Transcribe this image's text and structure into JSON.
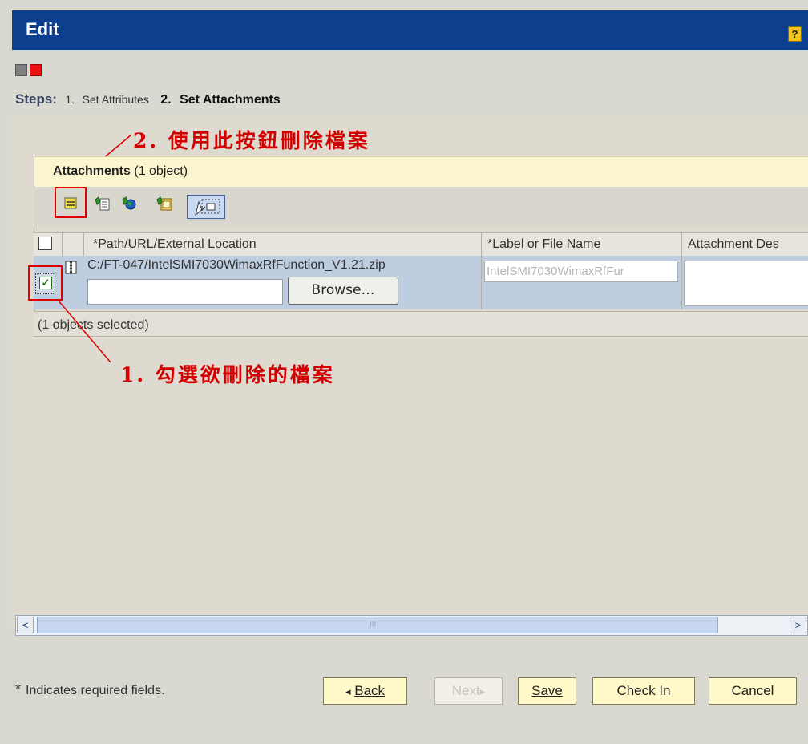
{
  "window": {
    "title": "Edit",
    "help_label": "?"
  },
  "steps": {
    "label": "Steps:",
    "items": [
      {
        "number": "1.",
        "label": "Set Attributes"
      },
      {
        "number": "2.",
        "label": "Set Attachments"
      }
    ]
  },
  "annotations": {
    "delete_hint": "2. 使用此按鈕刪除檔案",
    "select_hint": "1. 勾選欲刪除的檔案",
    "color": "#d20000"
  },
  "attachments": {
    "title": "Attachments",
    "count": "(1 object)",
    "toolbar": [
      "remove-attachment-icon",
      "add-file-icon",
      "add-url-icon",
      "add-document-icon",
      "select-mode-icon"
    ],
    "columns": [
      "*Path/URL/External Location",
      "*Label or File Name",
      "Attachment Des"
    ],
    "rows": [
      {
        "checked": true,
        "path": "C:/FT-047/IntelSMI7030WimaxRfFunction_V1.21.zip",
        "browse_label": "Browse…",
        "label": "IntelSMI7030WimaxRfFur",
        "description": ""
      }
    ],
    "selected_text": "(1 objects selected)"
  },
  "scrollbar": {
    "left_arrow": "<",
    "right_arrow": ">",
    "grip": "III"
  },
  "footer": {
    "required_star": "*",
    "required_note": "Indicates required fields.",
    "buttons": {
      "back_arrow": "◂",
      "back_label": "Back",
      "next_label": "Next",
      "next_arrow": "▸",
      "save_label": "Save",
      "check_in_label": "Check In",
      "cancel_label": "Cancel"
    }
  },
  "colors": {
    "title_bar": "#0d3f8f",
    "selected_row": "#bfcde0",
    "attachments_header": "#fbf6cf",
    "footer_button": "#fff8c8"
  }
}
